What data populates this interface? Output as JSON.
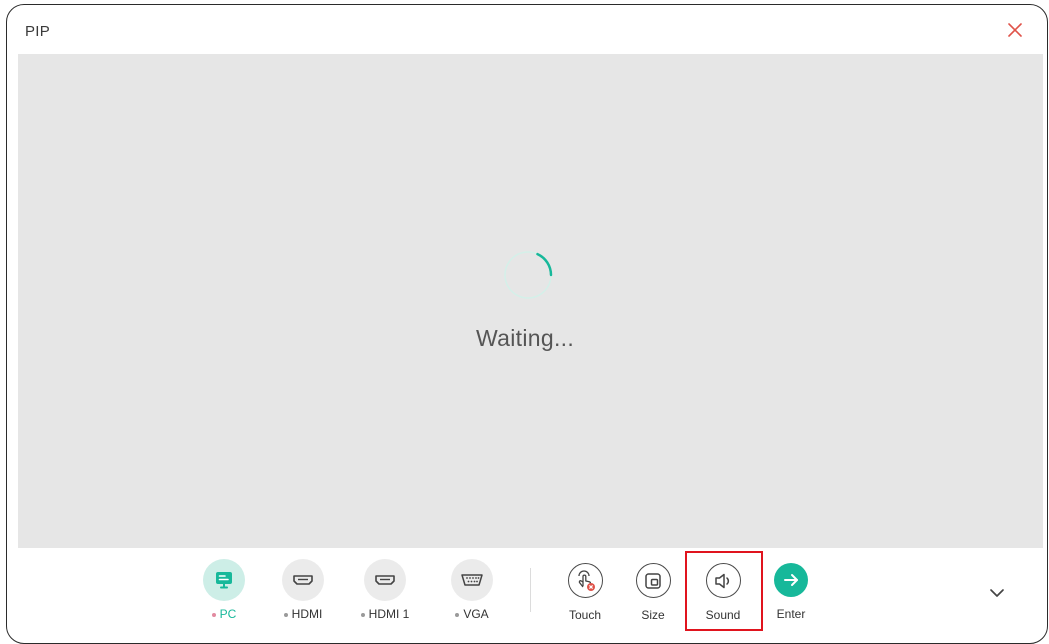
{
  "window": {
    "title": "PIP"
  },
  "preview": {
    "status_text": "Waiting..."
  },
  "sources": [
    {
      "label": "PC",
      "icon": "monitor-icon",
      "active": true
    },
    {
      "label": "HDMI",
      "icon": "hdmi-port-icon",
      "active": false
    },
    {
      "label": "HDMI 1",
      "icon": "hdmi-port-icon",
      "active": false
    },
    {
      "label": "VGA",
      "icon": "vga-port-icon",
      "active": false
    }
  ],
  "actions": [
    {
      "label": "Touch",
      "icon": "touch-disabled-icon"
    },
    {
      "label": "Size",
      "icon": "resize-window-icon"
    },
    {
      "label": "Sound",
      "icon": "speaker-icon",
      "highlighted": true
    },
    {
      "label": "Enter",
      "icon": "arrow-right-icon"
    }
  ],
  "colors": {
    "accent": "#17b89a",
    "close": "#e0534a",
    "highlight": "#e0141e",
    "preview_bg": "#e6e6e6"
  }
}
